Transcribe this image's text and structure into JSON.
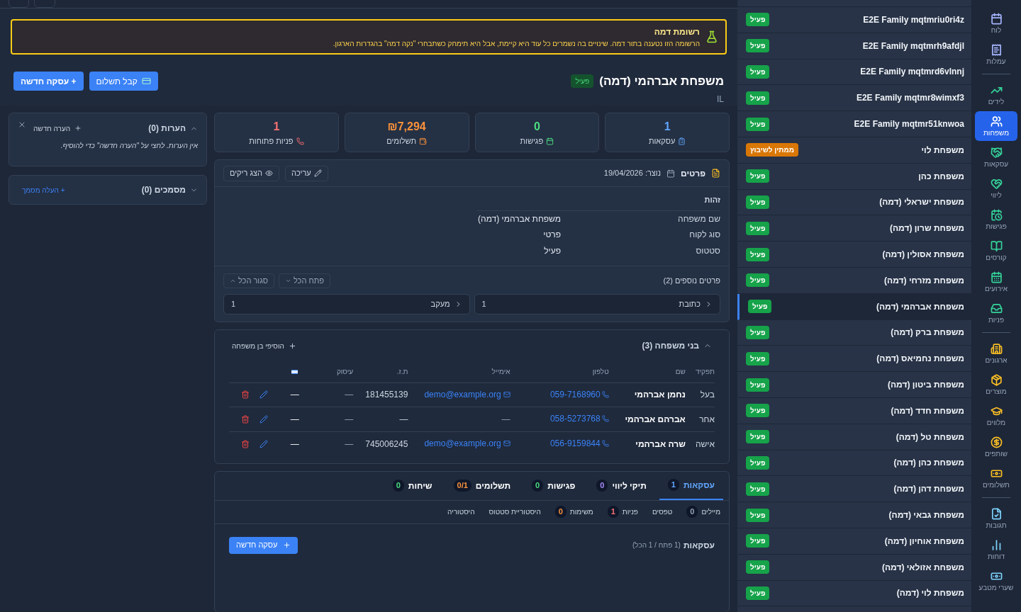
{
  "banner": {
    "title": "רשומת דמה",
    "text": "הרשומה הזו נטענה בתור דמה. שינויים בה נשמרים כל עוד היא קיימת, אבל היא תימחק כשתבחרי \"נקה דמה\" בהגדרות הארגון."
  },
  "header": {
    "title": "משפחת אברהמי (דמה)",
    "status": "פעיל",
    "country": "IL",
    "actions": [
      "קבל תשלום",
      "+ עסקה חדשה"
    ]
  },
  "stats": [
    {
      "value": "1",
      "label": "עסקאות",
      "color": "#60a5fa"
    },
    {
      "value": "0",
      "label": "פגישות",
      "color": "#4ade80"
    },
    {
      "value": "₪7,294",
      "label": "תשלומים",
      "color": "#fb923c"
    },
    {
      "value": "1",
      "label": "פניות פתוחות",
      "color": "#f87171"
    }
  ],
  "details": {
    "title": "פרטים",
    "created": "נוצר: 19/04/2026",
    "edit": "עריכה",
    "show_empty": "הצג ריקים",
    "section": "זהות",
    "fields": [
      {
        "label": "שם משפחה",
        "value": "משפחת אברהמי (דמה)"
      },
      {
        "label": "סוג לקוח",
        "value": "פרטי"
      },
      {
        "label": "סטטוס",
        "value": "פעיל"
      }
    ],
    "more_title": "פרטים נוספים (2)",
    "expand_all": "פתח הכל",
    "collapse_all": "סגור הכל",
    "groups": [
      {
        "label": "כתובת",
        "count": "1"
      },
      {
        "label": "מעקב",
        "count": "1"
      }
    ]
  },
  "family": {
    "title": "בני משפחה (3)",
    "add": "הוסיפי בן משפחה",
    "columns": [
      "תפקיד",
      "שם",
      "טלפון",
      "אימייל",
      "ת.ז.",
      "עיסוק"
    ],
    "rows": [
      {
        "role": "בעל",
        "name": "נחמן אברהמי",
        "phone": "059-7168960",
        "email": {
          "text": "demo@example.org",
          "link": true
        },
        "id": "181455139",
        "occupation": "—",
        "column_7": "—"
      },
      {
        "role": "אחר",
        "name": "אברהם אברהמי",
        "phone": "058-5273768",
        "email": {
          "text": "—",
          "link": false
        },
        "id": "—",
        "occupation": "—",
        "column_7": "—"
      },
      {
        "role": "אישה",
        "name": "שרה אברהמי",
        "phone": "056-9159844",
        "email": {
          "text": "demo@example.org",
          "link": true
        },
        "id": "745006245",
        "occupation": "—",
        "column_7": "—"
      }
    ]
  },
  "tabs": [
    {
      "label": "עסקאות",
      "count": "1",
      "color": "#60a5fa",
      "selected": true
    },
    {
      "label": "תיקי ליווי",
      "count": "0",
      "color": "#a78bfa",
      "selected": false
    },
    {
      "label": "פגישות",
      "count": "0",
      "color": "#4ade80",
      "selected": false
    },
    {
      "label": "תשלומים",
      "count": "0/1",
      "color": "#fb923c",
      "selected": false
    },
    {
      "label": "שיחות",
      "count": "0",
      "color": "#4ade80",
      "selected": false
    }
  ],
  "subtabs": [
    {
      "label": "מיילים",
      "count": "0",
      "color": "#94a3b8"
    },
    {
      "label": "טפסים"
    },
    {
      "label": "פניות",
      "count": "1",
      "color": "#f87171"
    },
    {
      "label": "משימות",
      "count": "0",
      "color": "#fb923c"
    },
    {
      "label": "היסטוריית סטטוס"
    },
    {
      "label": "היסטוריה"
    }
  ],
  "deals": {
    "title": "עסקאות",
    "summary": "(1 פתח / 1 הכל)",
    "new": "עסקה חדשה"
  },
  "notes": {
    "title": "הערות (0)",
    "new": "הערה חדשה",
    "empty": "אין הערות. לחצי על \"הערה חדשה\" כדי להוסיף."
  },
  "documents": {
    "title": "מסמכים (0)",
    "upload": "+ העלה מסמך"
  },
  "families": [
    {
      "name": "E2E Family mqtmriu0ri4z",
      "status": "פעיל",
      "kind": "active",
      "selected": false
    },
    {
      "name": "E2E Family mqtmrh9afdjl",
      "status": "פעיל",
      "kind": "active",
      "selected": false
    },
    {
      "name": "E2E Family mqtmrd6vlnnj",
      "status": "פעיל",
      "kind": "active",
      "selected": false
    },
    {
      "name": "E2E Family mqtmr8wimxf3",
      "status": "פעיל",
      "kind": "active",
      "selected": false
    },
    {
      "name": "E2E Family mqtmr51knwoa",
      "status": "פעיל",
      "kind": "active",
      "selected": false
    },
    {
      "name": "משפחת לוי",
      "status": "ממתין לשיבוץ",
      "kind": "pending",
      "selected": false
    },
    {
      "name": "משפחת כהן",
      "status": "פעיל",
      "kind": "active",
      "selected": false
    },
    {
      "name": "משפחת ישראלי (דמה)",
      "status": "פעיל",
      "kind": "active",
      "selected": false
    },
    {
      "name": "משפחת שרון (דמה)",
      "status": "פעיל",
      "kind": "active",
      "selected": false
    },
    {
      "name": "משפחת אסולין (דמה)",
      "status": "פעיל",
      "kind": "active",
      "selected": false
    },
    {
      "name": "משפחת מזרחי (דמה)",
      "status": "פעיל",
      "kind": "active",
      "selected": false
    },
    {
      "name": "משפחת אברהמי (דמה)",
      "status": "פעיל",
      "kind": "active",
      "selected": true
    },
    {
      "name": "משפחת ברק (דמה)",
      "status": "פעיל",
      "kind": "active",
      "selected": false
    },
    {
      "name": "משפחת נחמיאס (דמה)",
      "status": "פעיל",
      "kind": "active",
      "selected": false
    },
    {
      "name": "משפחת ביטון (דמה)",
      "status": "פעיל",
      "kind": "active",
      "selected": false
    },
    {
      "name": "משפחת חדד (דמה)",
      "status": "פעיל",
      "kind": "active",
      "selected": false
    },
    {
      "name": "משפחת טל (דמה)",
      "status": "פעיל",
      "kind": "active",
      "selected": false
    },
    {
      "name": "משפחת כהן (דמה)",
      "status": "פעיל",
      "kind": "active",
      "selected": false
    },
    {
      "name": "משפחת דהן (דמה)",
      "status": "פעיל",
      "kind": "active",
      "selected": false
    },
    {
      "name": "משפחת גבאי (דמה)",
      "status": "פעיל",
      "kind": "active",
      "selected": false
    },
    {
      "name": "משפחת אוחיון (דמה)",
      "status": "פעיל",
      "kind": "active",
      "selected": false
    },
    {
      "name": "משפחת אזולאי (דמה)",
      "status": "פעיל",
      "kind": "active",
      "selected": false
    },
    {
      "name": "משפחת לוי (דמה)",
      "status": "פעיל",
      "kind": "active",
      "selected": false
    }
  ],
  "nav": {
    "groups": [
      {
        "color": "#a5b4fc",
        "items": [
          {
            "label": "לוח",
            "selected": false
          },
          {
            "label": "עמלות",
            "selected": false
          }
        ]
      },
      {
        "color": "#34d399",
        "items": [
          {
            "label": "לידים",
            "selected": false
          },
          {
            "label": "משפחות",
            "selected": true
          },
          {
            "label": "עסקאות",
            "selected": false
          },
          {
            "label": "ליווי",
            "selected": false
          },
          {
            "label": "פגישות",
            "selected": false
          },
          {
            "label": "קורסים",
            "selected": false
          },
          {
            "label": "אירועים",
            "selected": false
          },
          {
            "label": "פניות",
            "selected": false
          }
        ]
      },
      {
        "color": "#fbbf24",
        "items": [
          {
            "label": "ארגונים",
            "selected": false
          },
          {
            "label": "מוצרים",
            "selected": false
          },
          {
            "label": "מלווים",
            "selected": false
          },
          {
            "label": "שותפים",
            "selected": false
          },
          {
            "label": "תשלומים",
            "selected": false
          }
        ]
      },
      {
        "color": "#7dd3fc",
        "items": [
          {
            "label": "תגובות",
            "selected": false
          },
          {
            "label": "דוחות",
            "selected": false
          },
          {
            "label": "שערי מטבע",
            "selected": false
          }
        ]
      }
    ]
  }
}
